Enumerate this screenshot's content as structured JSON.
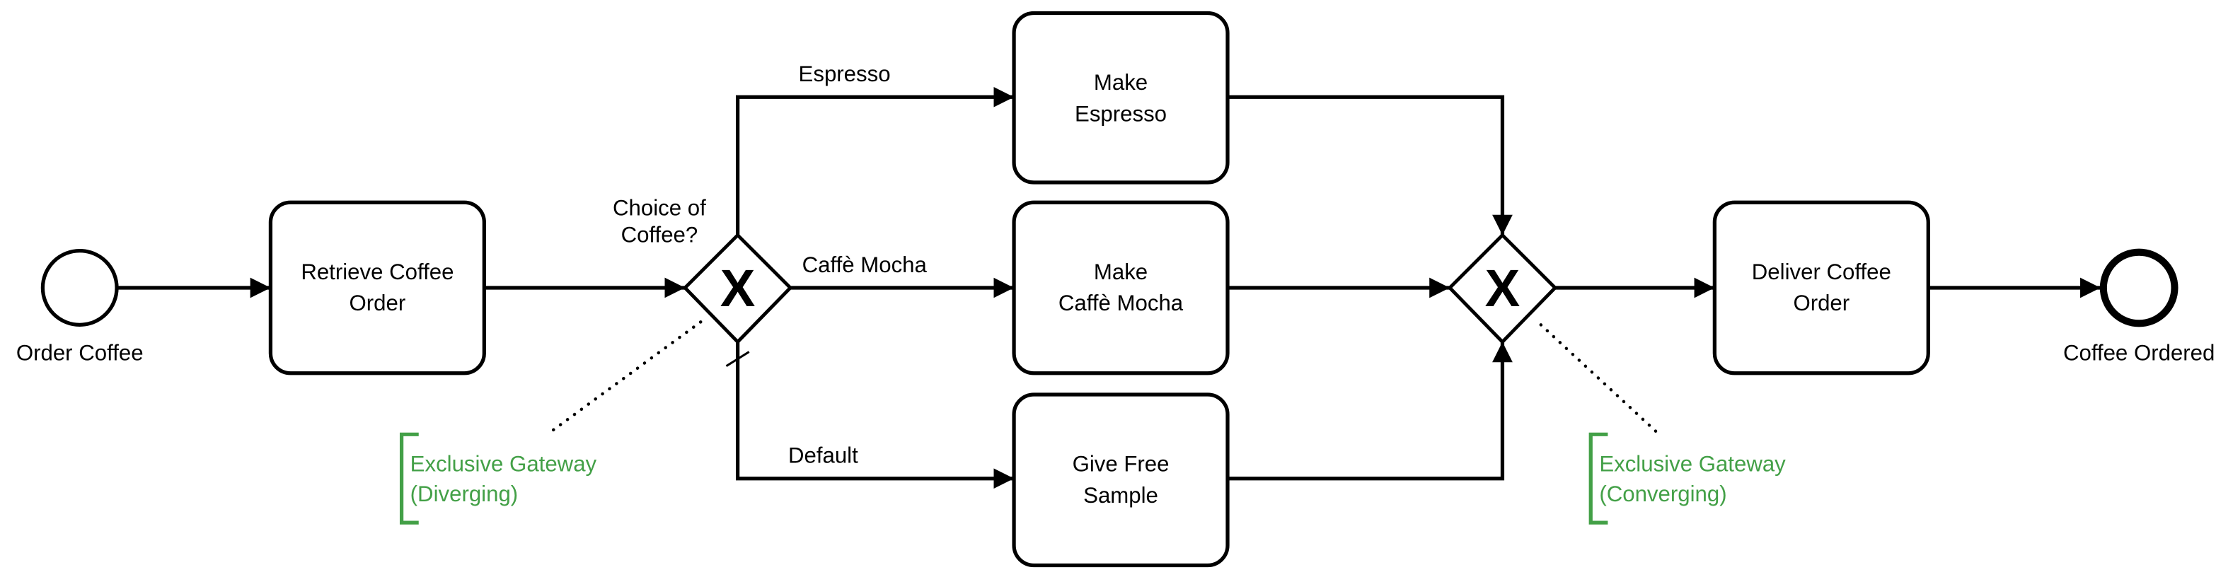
{
  "colors": {
    "annotation": "#43a047",
    "stroke": "#000000",
    "background": "#ffffff"
  },
  "events": {
    "start": {
      "label": "Order Coffee"
    },
    "end": {
      "label": "Coffee Ordered"
    }
  },
  "tasks": {
    "retrieve": {
      "line1": "Retrieve Coffee",
      "line2": "Order"
    },
    "espresso": {
      "line1": "Make",
      "line2": "Espresso"
    },
    "mocha": {
      "line1": "Make",
      "line2": "Caffè Mocha"
    },
    "sample": {
      "line1": "Give Free",
      "line2": "Sample"
    },
    "deliver": {
      "line1": "Deliver Coffee",
      "line2": "Order"
    }
  },
  "gateways": {
    "diverging": {
      "marker": "X",
      "question_line1": "Choice of",
      "question_line2": "Coffee?"
    },
    "converging": {
      "marker": "X"
    }
  },
  "flows": {
    "espresso": "Espresso",
    "mocha": "Caffè Mocha",
    "default": "Default"
  },
  "annotations": {
    "diverging": {
      "line1": "Exclusive Gateway",
      "line2": "(Diverging)"
    },
    "converging": {
      "line1": "Exclusive Gateway",
      "line2": "(Converging)"
    }
  }
}
